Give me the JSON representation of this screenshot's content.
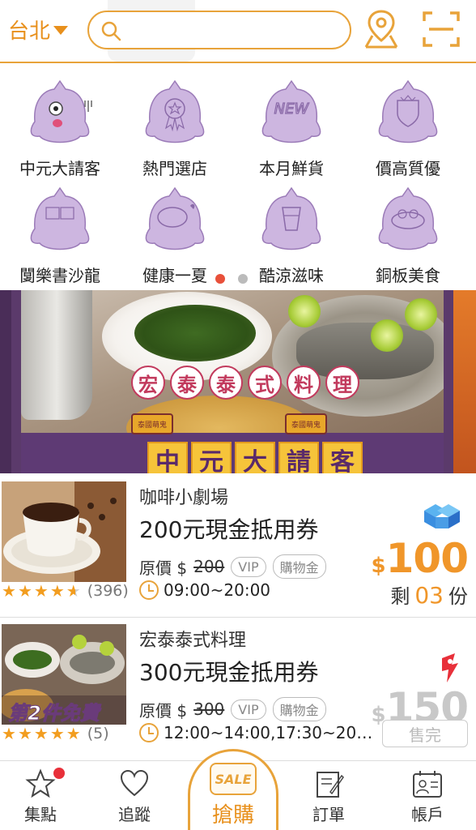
{
  "header": {
    "city": "台北",
    "search_placeholder": ""
  },
  "categories": [
    {
      "label": "中元大請客",
      "icon": "ghost-fork-icon"
    },
    {
      "label": "熱門選店",
      "icon": "ghost-ribbon-icon"
    },
    {
      "label": "本月鮮貨",
      "icon": "ghost-new-icon"
    },
    {
      "label": "價高質優",
      "icon": "ghost-crest-icon"
    },
    {
      "label": "闅樂書沙龍",
      "icon": "ghost-book-icon"
    },
    {
      "label": "健康一夏",
      "icon": "ghost-bowl-icon"
    },
    {
      "label": "酷涼滋味",
      "icon": "ghost-drink-icon"
    },
    {
      "label": "銅板美食",
      "icon": "ghost-food-icon"
    }
  ],
  "carousel": {
    "pages": 2,
    "active": 0
  },
  "banner": {
    "restaurant_chars": [
      "宏",
      "泰",
      "泰",
      "式",
      "料",
      "理"
    ],
    "promo_chars": [
      "中",
      "元",
      "大",
      "請",
      "客"
    ],
    "flag_text": "泰國萌鬼"
  },
  "deals": [
    {
      "shop": "咖啡小劇場",
      "title": "200元現金抵用券",
      "orig_label": "原價 $",
      "orig_price": "200",
      "tag_vip": "VIP",
      "tag_wallet": "購物金",
      "rating": 4.5,
      "reviews": "(396)",
      "hours": "09:00~20:00",
      "currency": "$",
      "price": "100",
      "remain_prefix": "剩",
      "remain_count": "03",
      "remain_suffix": "份",
      "status": "active"
    },
    {
      "shop": "宏泰泰式料理",
      "title": "300元現金抵用券",
      "orig_label": "原價 $",
      "orig_price": "300",
      "tag_vip": "VIP",
      "tag_wallet": "購物金",
      "rating": 5,
      "reviews": "(5)",
      "hours": "12:00~14:00,17:30~20…",
      "currency": "$",
      "price": "150",
      "thumb_caption": "第2件免費",
      "soldout_label": "售完",
      "status": "sold"
    }
  ],
  "tabs": [
    {
      "label": "集點",
      "icon": "star-icon",
      "has_badge": true
    },
    {
      "label": "追蹤",
      "icon": "heart-icon"
    },
    {
      "label": "搶購",
      "icon": "sale-tag-icon",
      "tag_text": "SALE",
      "active": true
    },
    {
      "label": "訂單",
      "icon": "order-icon"
    },
    {
      "label": "帳戶",
      "icon": "account-icon"
    }
  ],
  "colors": {
    "accent": "#e8a33a",
    "price": "#f0962a",
    "category_purple": "#c9b0df"
  }
}
